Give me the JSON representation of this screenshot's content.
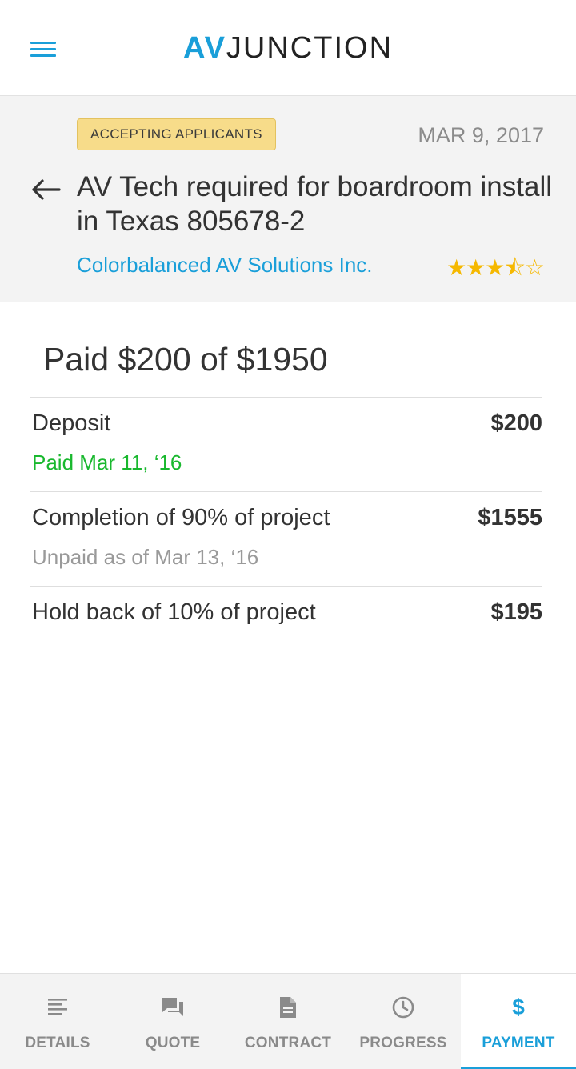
{
  "app": {
    "logo_primary": "AV",
    "logo_secondary": "JUNCTION"
  },
  "job": {
    "status_badge": "ACCEPTING APPLICANTS",
    "date": "MAR 9, 2017",
    "title": "AV Tech required for boardroom install in Texas 805678-2",
    "company": "Colorbalanced AV Solutions Inc.",
    "rating": 3.5,
    "rating_max": 5,
    "stars": "★★★⯪☆"
  },
  "payment": {
    "summary": "Paid $200 of $1950",
    "items": [
      {
        "label": "Deposit",
        "amount": "$200",
        "status": "Paid Mar 11, ‘16",
        "status_color": "#19b82e"
      },
      {
        "label": "Completion of 90% of project",
        "amount": "$1555",
        "status": "Unpaid as of Mar 13, ‘16",
        "status_color": "#9a9a9a"
      },
      {
        "label": "Hold back of 10% of project",
        "amount": "$195"
      }
    ]
  },
  "nav": {
    "tabs": [
      {
        "label": "DETAILS",
        "icon": "list-lines-icon"
      },
      {
        "label": "QUOTE",
        "icon": "chat-bubbles-icon"
      },
      {
        "label": "CONTRACT",
        "icon": "document-icon"
      },
      {
        "label": "PROGRESS",
        "icon": "clock-icon"
      },
      {
        "label": "PAYMENT",
        "icon": "dollar-icon",
        "active": true,
        "symbol": "$"
      }
    ]
  },
  "colors": {
    "accent": "#1a9fd9",
    "badge_bg": "#f7dc8a",
    "paid_green": "#19b82e",
    "star_gold": "#f5b800"
  }
}
